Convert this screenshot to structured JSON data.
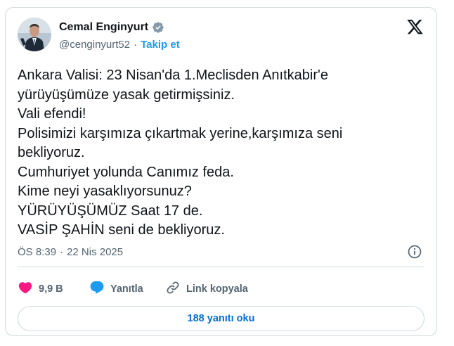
{
  "author": {
    "name": "Cemal Enginyurt",
    "handle": "@cenginyurt52",
    "separator": "·",
    "follow_label": "Takip et",
    "verified": true
  },
  "tweet": {
    "lines": [
      "Ankara Valisi: 23 Nisan'da 1.Meclisden Anıtkabir'e",
      "yürüyüşümüze yasak getirmişsiniz.",
      "Vali efendi!",
      "Polisimizi karşımıza çıkartmak yerine,karşımıza seni",
      "bekliyoruz.",
      "Cumhuriyet yolunda Canımız feda.",
      "Kime neyi yasaklıyorsunuz?",
      "YÜRÜYÜŞÜMÜZ Saat 17 de.",
      "VASİP ŞAHİN seni de bekliyoruz."
    ],
    "time": "ÖS 8:39",
    "separator": "·",
    "date": "22 Nis 2025"
  },
  "actions": {
    "like_count": "9,9 B",
    "reply_label": "Yanıtla",
    "copy_link_label": "Link kopyala"
  },
  "footer": {
    "read_replies_label": "188 yanıtı oku"
  },
  "colors": {
    "accent": "#1d9bf0",
    "like": "#f91880",
    "secondary_text": "#536471",
    "border": "#cfd9de",
    "link_button_text": "#006fd6"
  },
  "icons": {
    "brand": "x-logo-icon",
    "verified": "verified-badge-icon",
    "like": "heart-icon",
    "reply": "speech-bubble-icon",
    "copy_link": "link-icon",
    "info": "info-icon"
  }
}
